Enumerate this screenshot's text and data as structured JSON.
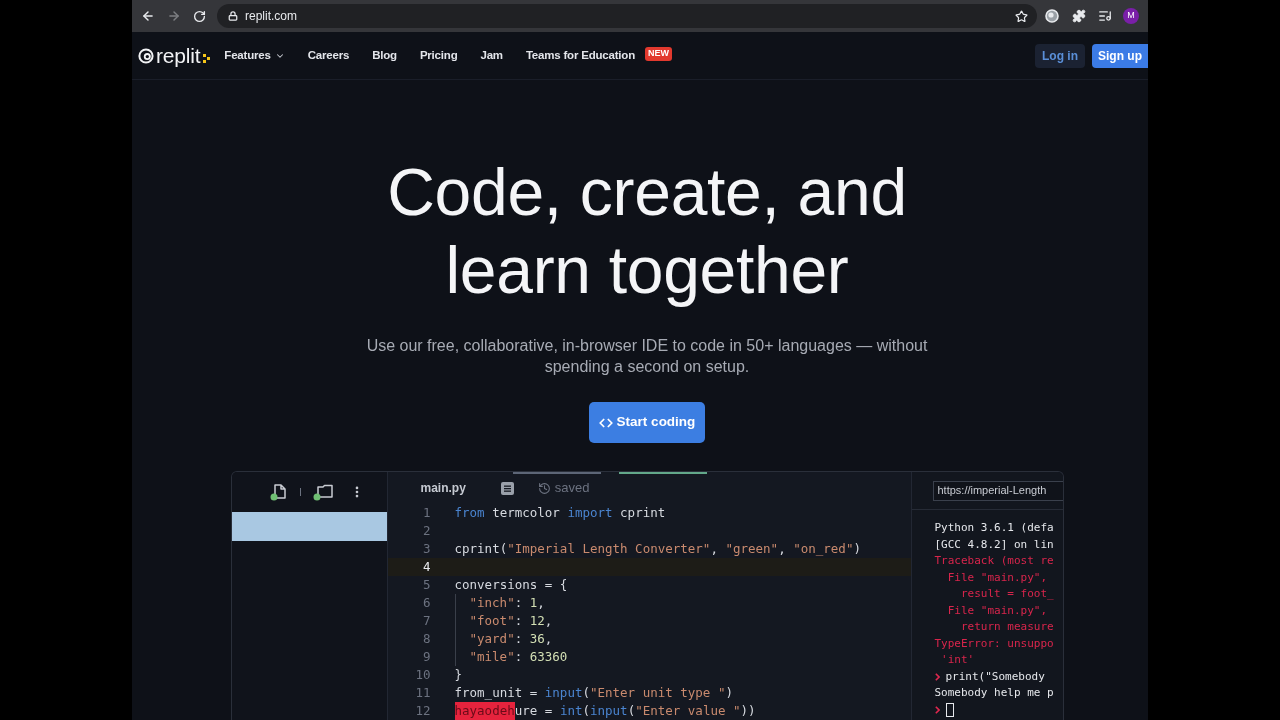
{
  "browser": {
    "url": "replit.com",
    "forward_disabled": true,
    "avatar_initial": "M"
  },
  "nav": {
    "logo_text": "replit",
    "links": [
      {
        "label": "Features",
        "dropdown": true
      },
      {
        "label": "Careers",
        "dropdown": false
      },
      {
        "label": "Blog",
        "dropdown": false
      },
      {
        "label": "Pricing",
        "dropdown": false
      },
      {
        "label": "Jam",
        "dropdown": false
      },
      {
        "label": "Teams for Education",
        "dropdown": false,
        "badge": "NEW"
      }
    ],
    "login": "Log in",
    "signup": "Sign up"
  },
  "hero": {
    "title_lines": [
      "Code, create, and",
      "learn together"
    ],
    "subtitle": "Use our free, collaborative, in-browser IDE to code in 50+ languages — without spending a second on setup.",
    "cta": "Start coding"
  },
  "editor": {
    "file_rows": [
      {
        "selected": true
      }
    ],
    "tab": {
      "filename": "main.py",
      "status": "saved"
    },
    "code_lines": [
      {
        "number": "1",
        "current": false,
        "indented": false,
        "tokens": [
          {
            "kind": "keyword",
            "text": "from"
          },
          {
            "kind": "plain",
            "text": " termcolor "
          },
          {
            "kind": "keyword",
            "text": "import"
          },
          {
            "kind": "plain",
            "text": " cprint"
          }
        ]
      },
      {
        "number": "2",
        "current": false
      },
      {
        "number": "3",
        "current": false,
        "indented": false,
        "tokens": [
          {
            "kind": "plain",
            "text": "cprint("
          },
          {
            "kind": "string",
            "text": "\"Imperial Length Converter\""
          },
          {
            "kind": "plain",
            "text": ", "
          },
          {
            "kind": "string",
            "text": "\"green\""
          },
          {
            "kind": "plain",
            "text": ", "
          },
          {
            "kind": "string",
            "text": "\"on_red\""
          },
          {
            "kind": "plain",
            "text": ")"
          }
        ]
      },
      {
        "number": "4",
        "current": true
      },
      {
        "number": "5",
        "current": false,
        "indented": false,
        "tokens": [
          {
            "kind": "plain",
            "text": "conversions = {"
          }
        ]
      },
      {
        "number": "6",
        "current": false,
        "indented": true,
        "tokens": [
          {
            "kind": "string",
            "text": "\"inch\""
          },
          {
            "kind": "plain",
            "text": ": "
          },
          {
            "kind": "number",
            "text": "1"
          },
          {
            "kind": "plain",
            "text": ","
          }
        ]
      },
      {
        "number": "7",
        "current": false,
        "indented": true,
        "tokens": [
          {
            "kind": "string",
            "text": "\"foot\""
          },
          {
            "kind": "plain",
            "text": ": "
          },
          {
            "kind": "number",
            "text": "12"
          },
          {
            "kind": "plain",
            "text": ","
          }
        ]
      },
      {
        "number": "8",
        "current": false,
        "indented": true,
        "tokens": [
          {
            "kind": "string",
            "text": "\"yard\""
          },
          {
            "kind": "plain",
            "text": ": "
          },
          {
            "kind": "number",
            "text": "36"
          },
          {
            "kind": "plain",
            "text": ","
          }
        ]
      },
      {
        "number": "9",
        "current": false,
        "indented": true,
        "tokens": [
          {
            "kind": "string",
            "text": "\"mile\""
          },
          {
            "kind": "plain",
            "text": ": "
          },
          {
            "kind": "number",
            "text": "63360"
          }
        ]
      },
      {
        "number": "10",
        "current": false,
        "indented": false,
        "tokens": [
          {
            "kind": "plain",
            "text": "}"
          }
        ]
      },
      {
        "number": "11",
        "current": false,
        "indented": false,
        "tokens": [
          {
            "kind": "plain",
            "text": "from_unit = "
          },
          {
            "kind": "builtin",
            "text": "input"
          },
          {
            "kind": "plain",
            "text": "("
          },
          {
            "kind": "string",
            "text": "\"Enter unit type \""
          },
          {
            "kind": "plain",
            "text": ")"
          }
        ]
      },
      {
        "number": "12",
        "current": false,
        "indented": false,
        "tokens": [
          {
            "kind": "collaborator",
            "text": "hayaodeh"
          },
          {
            "kind": "plain",
            "text": "ure = "
          },
          {
            "kind": "builtin",
            "text": "int"
          },
          {
            "kind": "plain",
            "text": "("
          },
          {
            "kind": "builtin",
            "text": "input"
          },
          {
            "kind": "plain",
            "text": "("
          },
          {
            "kind": "string",
            "text": "\"Enter value \""
          },
          {
            "kind": "plain",
            "text": "))"
          }
        ]
      }
    ],
    "preview_url": "https://imperial-Length",
    "console_lines": [
      {
        "kind": "output",
        "text": "Python 3.6.1 (defa"
      },
      {
        "kind": "output",
        "text": "[GCC 4.8.2] on lin"
      },
      {
        "kind": "error",
        "text": "Traceback (most re"
      },
      {
        "kind": "error",
        "text": "  File \"main.py\","
      },
      {
        "kind": "error",
        "text": "    result = foot_"
      },
      {
        "kind": "error",
        "text": "  File \"main.py\","
      },
      {
        "kind": "error",
        "text": "    return measure"
      },
      {
        "kind": "error",
        "text": "TypeError: unsuppo"
      },
      {
        "kind": "error",
        "text": " 'int'"
      },
      {
        "kind": "input",
        "text": "print(\"Somebody"
      },
      {
        "kind": "output",
        "text": "Somebody help me p"
      },
      {
        "kind": "prompt"
      }
    ]
  }
}
